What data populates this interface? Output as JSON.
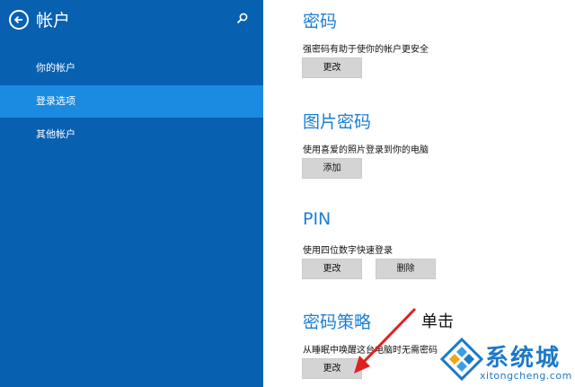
{
  "sidebar": {
    "title": "帐户",
    "items": [
      {
        "label": "你的帐户"
      },
      {
        "label": "登录选项"
      },
      {
        "label": "其他帐户"
      }
    ]
  },
  "sections": {
    "password": {
      "title": "密码",
      "desc": "强密码有助于使你的帐户更安全",
      "button": "更改"
    },
    "picture": {
      "title": "图片密码",
      "desc": "使用喜爱的照片登录到你的电脑",
      "button": "添加"
    },
    "pin": {
      "title": "PIN",
      "desc": "使用四位数字快速登录",
      "button_change": "更改",
      "button_delete": "删除"
    },
    "policy": {
      "title": "密码策略",
      "desc": "从睡眠中唤醒这台电脑时无需密码",
      "button": "更改"
    }
  },
  "annotation": {
    "text": "单击",
    "color": "#e02020"
  },
  "watermark": {
    "name": "系统城",
    "url": "xitongcheng.com"
  },
  "colors": {
    "sidebar": "#0860b0",
    "active_item": "#1a8be0",
    "accent": "#1a7fd4",
    "button": "#d4d4d4"
  }
}
